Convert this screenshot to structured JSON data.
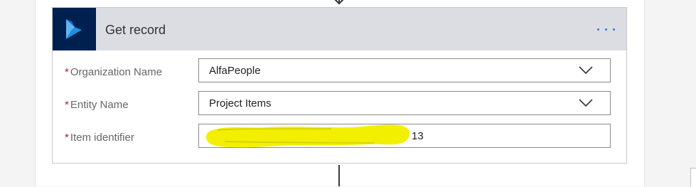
{
  "action": {
    "title": "Get record",
    "connector_icon": "dynamics-365-icon",
    "menu_icon": "ellipsis-icon"
  },
  "fields": [
    {
      "label": "Organization Name",
      "required_mark": "*",
      "value": "AlfaPeople",
      "type": "dropdown"
    },
    {
      "label": "Entity Name",
      "required_mark": "*",
      "value": "Project Items",
      "type": "dropdown"
    },
    {
      "label": "Item identifier",
      "required_mark": "*",
      "value_visible_suffix": "13",
      "type": "text",
      "redacted": true
    }
  ],
  "colors": {
    "brand_tile": "#002050",
    "brand_logo": "#1d8fe1",
    "header_bg": "#dcdde2",
    "required": "#c0181f",
    "redaction": "#f2f000",
    "ellipsis": "#2f7ad6"
  }
}
